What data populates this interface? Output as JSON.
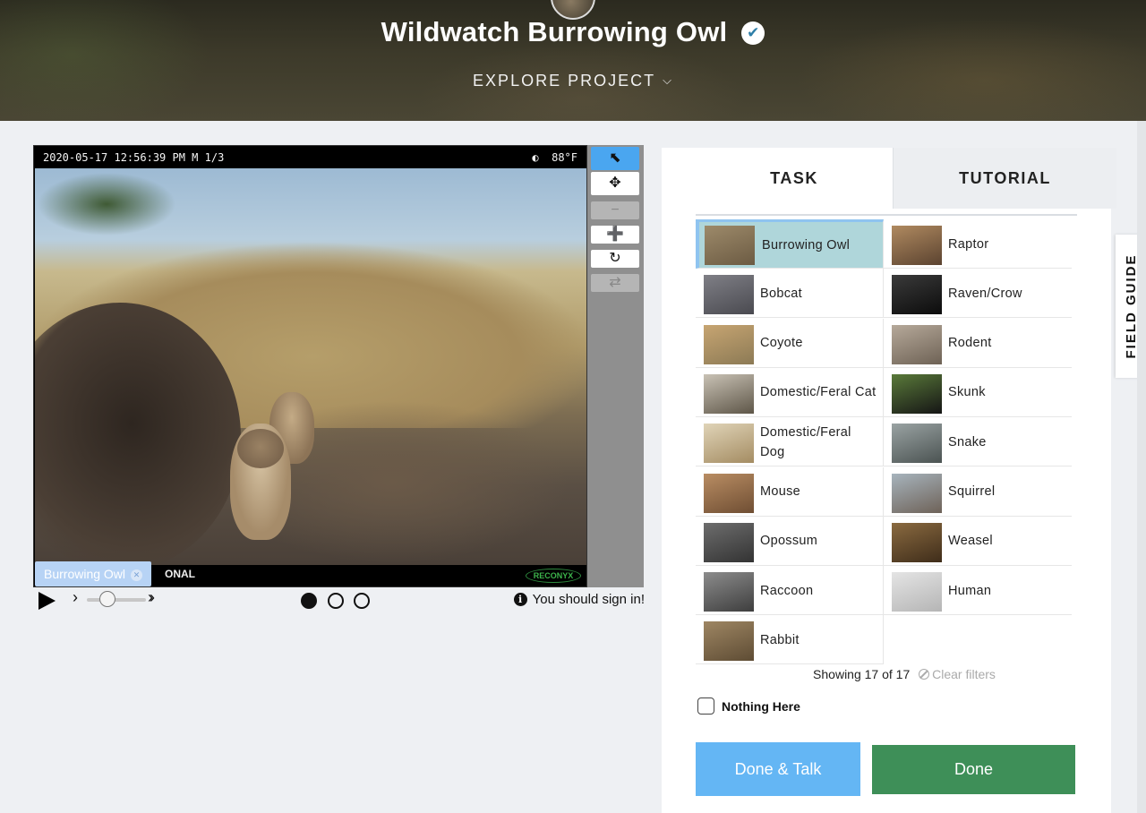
{
  "header": {
    "title": "Wildwatch Burrowing Owl",
    "explore_label": "EXPLORE PROJECT"
  },
  "viewer": {
    "timestamp": "2020-05-17 12:56:39 PM  M 1/3",
    "temperature": "88°F",
    "watermark_partial": "ONAL",
    "camera_brand": "RECONYX",
    "tag_label": "Burrowing Owl",
    "frames_total": 3,
    "frame_current": 1,
    "playback_progress": 0.25,
    "signin_text": "You should sign in!"
  },
  "tabs": {
    "task": "TASK",
    "tutorial": "TUTORIAL"
  },
  "choices": {
    "left": [
      "Burrowing Owl",
      "Bobcat",
      "Coyote",
      "Domestic/Feral Cat",
      "Domestic/Feral Dog",
      "Mouse",
      "Opossum",
      "Raccoon",
      "Rabbit"
    ],
    "right": [
      "Raptor",
      "Raven/Crow",
      "Rodent",
      "Skunk",
      "Snake",
      "Squirrel",
      "Weasel",
      "Human"
    ],
    "selected": "Burrowing Owl"
  },
  "filters": {
    "showing": "Showing 17 of 17",
    "clear": "Clear filters"
  },
  "nothing_here": "Nothing Here",
  "buttons": {
    "done_talk": "Done & Talk",
    "done": "Done"
  },
  "field_guide": "FIELD GUIDE",
  "colors": {
    "accent_blue": "#64b6f4",
    "done_green": "#3e8f58",
    "selected_choice": "#afd6da",
    "active_tool": "#4aa6f0"
  },
  "icons": {
    "verified": "check-circle-icon",
    "explore": "chevron-down-icon",
    "tools": [
      "pointer-icon",
      "move-icon",
      "zoom-out-icon",
      "zoom-in-icon",
      "rotate-icon",
      "reset-icon"
    ],
    "info": "info-icon"
  }
}
